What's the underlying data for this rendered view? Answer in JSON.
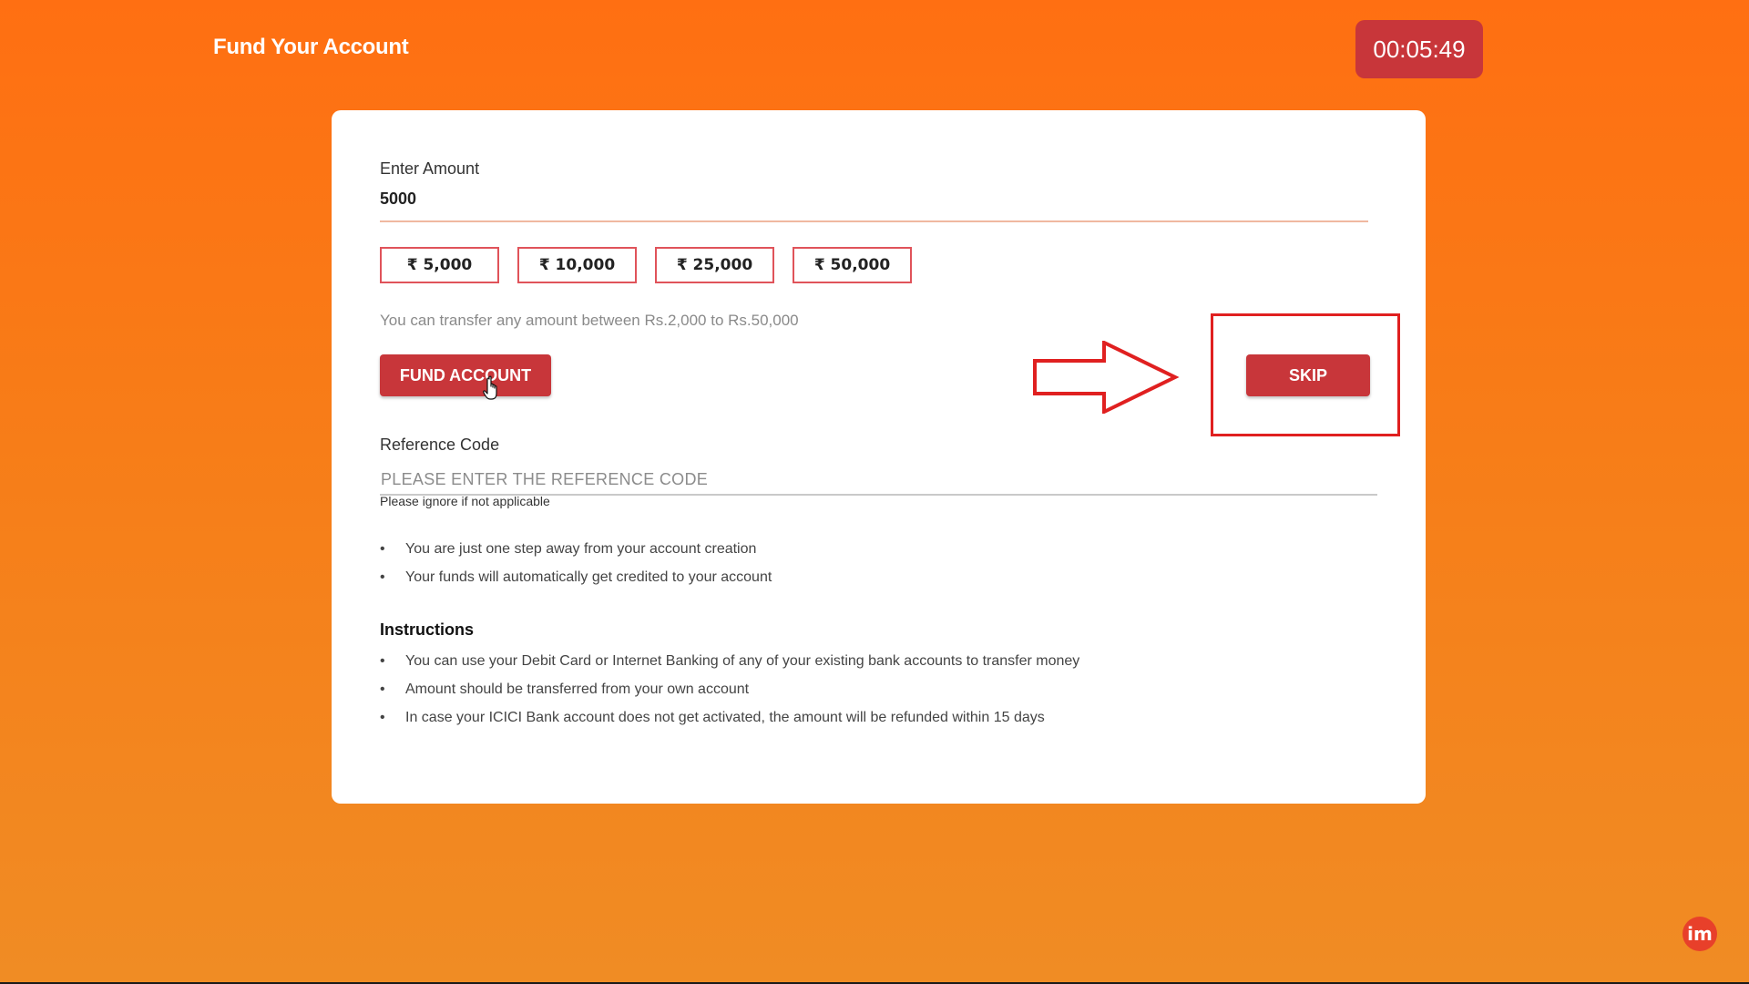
{
  "header": {
    "title": "Fund Your Account",
    "timer": "00:05:49"
  },
  "form": {
    "amount_label": "Enter Amount",
    "amount_value": "5000",
    "quick_amounts": [
      "₹ 5,000",
      "₹ 10,000",
      "₹ 25,000",
      "₹ 50,000"
    ],
    "range_note": "You can transfer any amount between Rs.2,000 to Rs.50,000",
    "fund_button": "FUND ACCOUNT",
    "skip_button": "SKIP",
    "reference_label": "Reference Code",
    "reference_placeholder": "PLEASE ENTER THE REFERENCE CODE",
    "reference_hint": "Please ignore if not applicable"
  },
  "notes": [
    "You are just one step away from your account creation",
    "Your funds will automatically get credited to your account"
  ],
  "instructions": {
    "heading": "Instructions",
    "items": [
      "You can use your Debit Card or Internet Banking of any of your existing bank accounts to transfer money",
      "Amount should be transferred from your own account",
      "In case your ICICI Bank account does not get activated, the amount will be refunded within 15 days"
    ]
  },
  "watermark": {
    "logo_text": "im"
  },
  "colors": {
    "background_top": "#ff6f12",
    "background_bottom": "#f08c24",
    "button_red": "#c8363a",
    "chip_border": "#e0535a",
    "annotation_red": "#e02020"
  },
  "icons": {
    "cursor": "hand-pointer-icon",
    "arrow": "right-arrow-outline-icon"
  }
}
